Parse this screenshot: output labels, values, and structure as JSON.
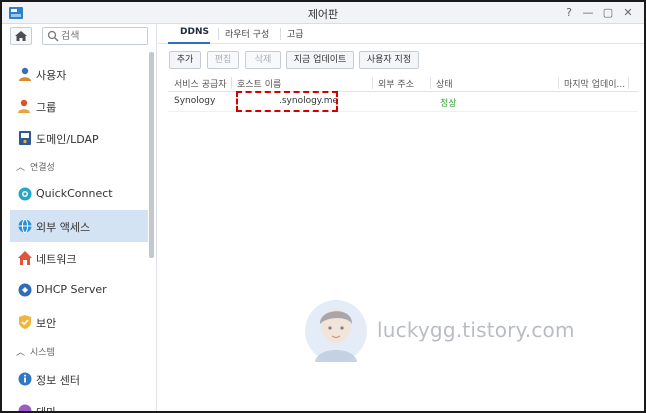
{
  "window": {
    "title": "제어판",
    "buttons": {
      "pin": "⌖",
      "help": "?",
      "minimize": "—",
      "maximize": "▢",
      "close": "✕"
    }
  },
  "search": {
    "placeholder": "검색"
  },
  "sidebar": {
    "items": [
      {
        "label": "사용자",
        "icon": "user-icon"
      },
      {
        "label": "그룹",
        "icon": "group-icon"
      },
      {
        "label": "도메인/LDAP",
        "icon": "domain-ldap-icon"
      },
      {
        "section": "연결성"
      },
      {
        "label": "QuickConnect",
        "icon": "quickconnect-icon"
      },
      {
        "label": "외부 액세스",
        "icon": "external-access-icon",
        "active": true
      },
      {
        "label": "네트워크",
        "icon": "network-icon"
      },
      {
        "label": "DHCP Server",
        "icon": "dhcp-icon"
      },
      {
        "label": "보안",
        "icon": "security-shield-icon"
      },
      {
        "section": "시스템"
      },
      {
        "label": "정보 센터",
        "icon": "info-icon"
      },
      {
        "label": "테마",
        "icon": "theme-icon"
      }
    ]
  },
  "tabs": [
    {
      "label": "DDNS",
      "active": true
    },
    {
      "label": "라우터 구성"
    },
    {
      "label": "고급"
    }
  ],
  "toolbar": {
    "add": "추가",
    "edit": "편집",
    "delete": "삭제",
    "update_now": "지금 업데이트",
    "customize": "사용자 지정"
  },
  "table": {
    "columns": [
      "서비스 공급자",
      "호스트 이름",
      "외부 주소",
      "상태",
      "마지막 업데이..."
    ],
    "rows": [
      {
        "provider": "Synology",
        "hostname": ".synology.me",
        "external_address": "",
        "status": "정상",
        "last_update": ""
      }
    ]
  },
  "watermark": {
    "text": "luckygg.tistory.com"
  },
  "colors": {
    "accent": "#2b6fbe",
    "active_bg": "#d4e3f4",
    "status_ok": "#39a039",
    "highlight": "#d40000"
  }
}
